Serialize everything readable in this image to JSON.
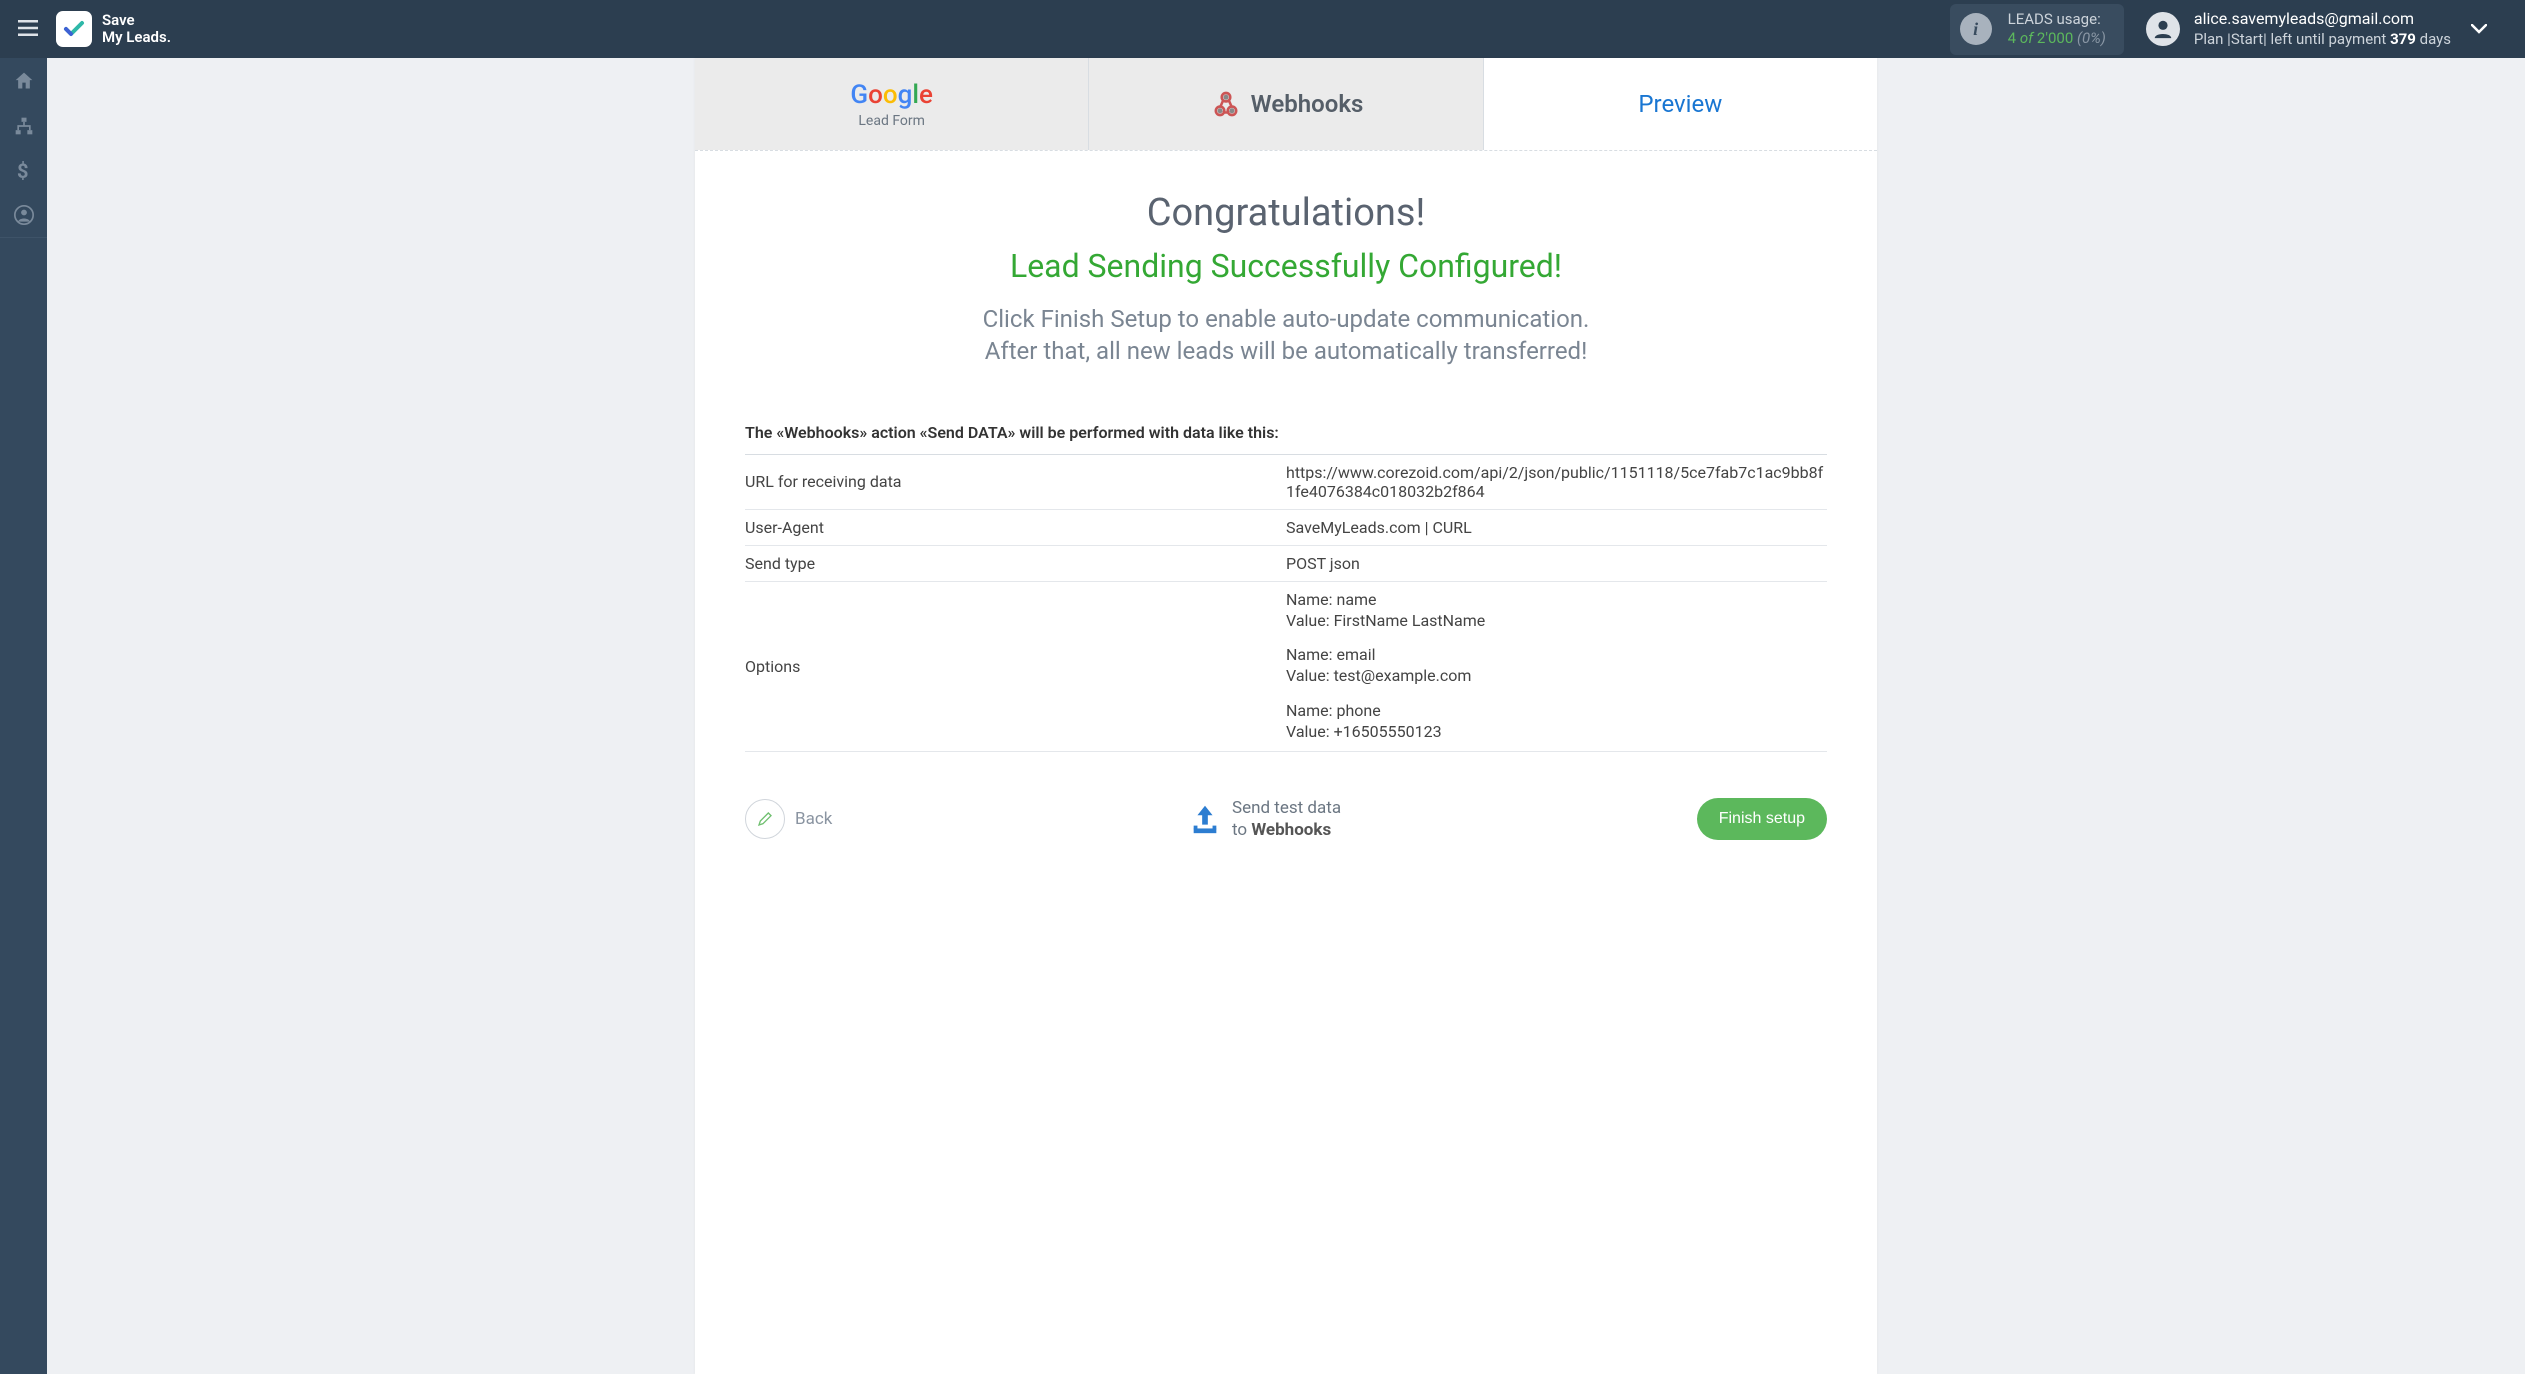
{
  "header": {
    "brand": {
      "line1": "Save",
      "line2": "My Leads."
    },
    "leads_usage": {
      "label": "LEADS usage:",
      "count": "4",
      "of": "of",
      "max": "2'000",
      "percent": "(0%)"
    },
    "account": {
      "email": "alice.savemyleads@gmail.com",
      "plan_prefix": "Plan |",
      "plan_name": "Start",
      "plan_suffix": "| left until payment",
      "days": "379",
      "days_suffix": "days"
    }
  },
  "tabs": {
    "google": {
      "word": "Google",
      "subtitle": "Lead Form"
    },
    "webhooks": {
      "label": "Webhooks"
    },
    "preview": {
      "label": "Preview"
    }
  },
  "main": {
    "title": "Congratulations!",
    "success": "Lead Sending Successfully Configured!",
    "instructions_line1": "Click Finish Setup to enable auto-update communication.",
    "instructions_line2": "After that, all new leads will be automatically transferred!",
    "action_label": "The «Webhooks» action «Send DATA» will be performed with data like this:",
    "rows": [
      {
        "label": "URL for receiving data",
        "value": "https://www.corezoid.com/api/2/json/public/1151118/5ce7fab7c1ac9bb8f1fe4076384c018032b2f864"
      },
      {
        "label": "User-Agent",
        "value": "SaveMyLeads.com | CURL"
      },
      {
        "label": "Send type",
        "value": "POST json"
      }
    ],
    "options_label": "Options",
    "options": [
      {
        "name": "name",
        "value": "FirstName LastName"
      },
      {
        "name": "email",
        "value": "test@example.com"
      },
      {
        "name": "phone",
        "value": "+16505550123"
      }
    ],
    "option_name_prefix": "Name:",
    "option_value_prefix": "Value:"
  },
  "footer": {
    "back": "Back",
    "send_test_line1": "Send test data",
    "send_test_prefix": "to",
    "send_test_target": "Webhooks",
    "finish": "Finish setup"
  }
}
